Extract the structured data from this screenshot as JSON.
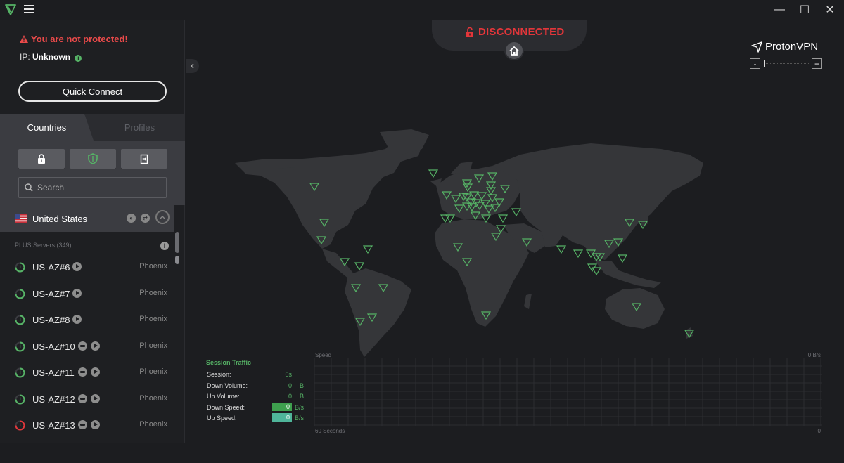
{
  "window": {
    "minimize_glyph": "—",
    "maximize_glyph": "☐",
    "close_glyph": "✕"
  },
  "sidebar": {
    "warning": "You are not protected!",
    "ip_label": "IP:",
    "ip_value": "Unknown",
    "quick_connect_label": "Quick Connect",
    "tabs": [
      {
        "label": "Countries",
        "active": true
      },
      {
        "label": "Profiles",
        "active": false
      }
    ],
    "filters": [
      {
        "icon": "lock-icon"
      },
      {
        "icon": "shield-icon"
      },
      {
        "icon": "p2p-icon"
      }
    ],
    "search_placeholder": "Search",
    "country": {
      "name": "United States",
      "flag": "us-flag"
    },
    "list_header": "PLUS Servers (349)",
    "servers": [
      {
        "name": "US-AZ#6",
        "city": "Phoenix",
        "load_color": "#56b366",
        "features": [
          "play"
        ]
      },
      {
        "name": "US-AZ#7",
        "city": "Phoenix",
        "load_color": "#56b366",
        "features": [
          "play"
        ]
      },
      {
        "name": "US-AZ#8",
        "city": "Phoenix",
        "load_color": "#56b366",
        "features": [
          "play"
        ]
      },
      {
        "name": "US-AZ#10",
        "city": "Phoenix",
        "load_color": "#56b366",
        "features": [
          "tor",
          "play"
        ]
      },
      {
        "name": "US-AZ#11",
        "city": "Phoenix",
        "load_color": "#56b366",
        "features": [
          "tor",
          "play"
        ]
      },
      {
        "name": "US-AZ#12",
        "city": "Phoenix",
        "load_color": "#56b366",
        "features": [
          "tor",
          "play"
        ]
      },
      {
        "name": "US-AZ#13",
        "city": "Phoenix",
        "load_color": "#e3363a",
        "features": [
          "tor",
          "play"
        ]
      }
    ]
  },
  "status": {
    "text": "DISCONNECTED",
    "color": "#e3363a"
  },
  "brand": {
    "name": "ProtonVPN",
    "zoom_minus": "-",
    "zoom_plus": "+"
  },
  "traffic": {
    "title": "Session Traffic",
    "rows": [
      {
        "label": "Session:",
        "value": "0s",
        "unit": ""
      },
      {
        "label": "Down Volume:",
        "value": "0",
        "unit": "B"
      },
      {
        "label": "Up Volume:",
        "value": "0",
        "unit": "B"
      },
      {
        "label": "Down Speed:",
        "value": "0",
        "unit": "B/s"
      },
      {
        "label": "Up Speed:",
        "value": "0",
        "unit": "B/s"
      }
    ],
    "down_speed_color": "#3ea04e",
    "up_speed_color": "#4fb59a"
  },
  "graph": {
    "y_label": "Speed",
    "y_max": "0  B/s",
    "x_left": "60 Seconds",
    "x_right": "0"
  },
  "colors": {
    "accent_green": "#56b366",
    "danger_red": "#e3363a"
  }
}
